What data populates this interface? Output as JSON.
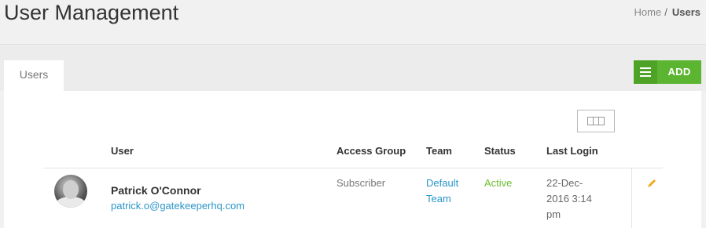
{
  "header": {
    "title": "User Management",
    "breadcrumb": {
      "home": "Home",
      "separator": "/",
      "current": "Users"
    }
  },
  "tabs": [
    {
      "label": "Users",
      "active": true
    }
  ],
  "toolbar": {
    "add_label": "ADD",
    "add_color": "#5cb531"
  },
  "table": {
    "columns": [
      "User",
      "Access Group",
      "Team",
      "Status",
      "Last Login"
    ],
    "rows": [
      {
        "name": "Patrick O'Connor",
        "email": "patrick.o@gatekeeperhq.com",
        "access_group": "Subscriber",
        "team": "Default Team",
        "status": "Active",
        "last_login": "22-Dec-2016 3:14 pm"
      }
    ]
  },
  "colors": {
    "link": "#2a96c9",
    "status_active": "#6cbf2f",
    "edit_icon": "#f0a818"
  }
}
